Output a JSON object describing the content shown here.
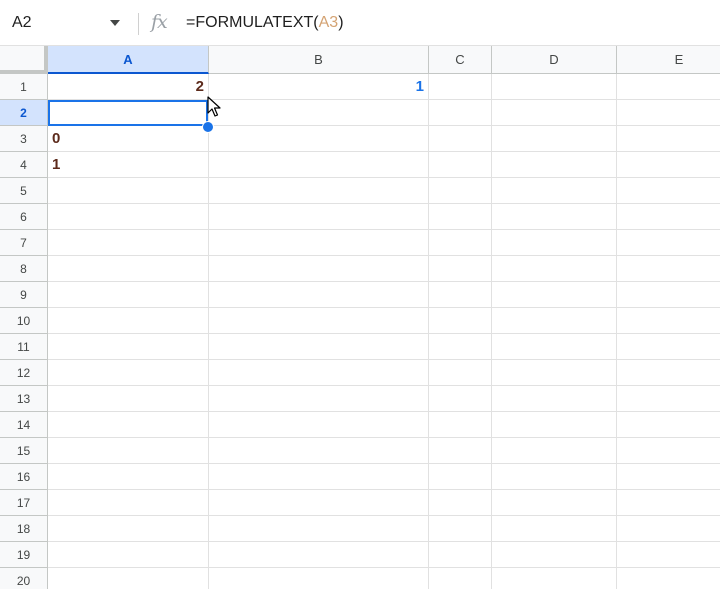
{
  "formula_bar": {
    "name_box": "A2",
    "fx_label": "fx",
    "formula_prefix": "=FORMULATEXT(",
    "formula_ref": "A3",
    "formula_suffix": ")"
  },
  "columns": [
    "A",
    "B",
    "C",
    "D",
    "E"
  ],
  "rows": [
    "1",
    "2",
    "3",
    "4",
    "5",
    "6",
    "7",
    "8",
    "9",
    "10",
    "11",
    "12",
    "13",
    "14",
    "15",
    "16",
    "17",
    "18",
    "19",
    "20"
  ],
  "selection": {
    "column": "A",
    "row": "2"
  },
  "cells": {
    "A1": "2",
    "B1": "1",
    "A3": "0",
    "A4": "1"
  },
  "colors": {
    "accent": "#1a73e8",
    "header_selected_bg": "#d3e3fd",
    "value_brown": "#5c2a1b",
    "ref_highlight": "#d4a373"
  },
  "icons": [
    "fx-icon",
    "dropdown-arrow-icon",
    "mouse-cursor-icon",
    "fill-handle-icon"
  ]
}
